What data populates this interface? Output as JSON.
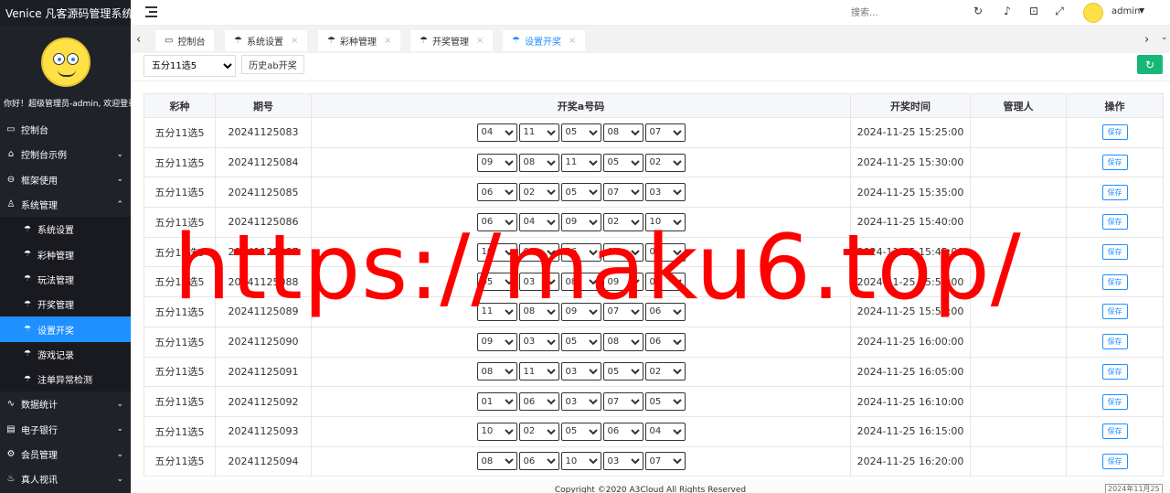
{
  "app": {
    "title": "Venice 凡客源码管理系统",
    "welcome": "你好！超级管理员-admin, 欢迎登录"
  },
  "sidebar": {
    "items": [
      {
        "label": "控制台",
        "icon": "monitor-icon",
        "glyph": "▭",
        "chevron": ""
      },
      {
        "label": "控制台示例",
        "icon": "home-icon",
        "glyph": "⌂",
        "chevron": "⌄"
      },
      {
        "label": "框架使用",
        "icon": "framework-icon",
        "glyph": "⊖",
        "chevron": "⌄"
      },
      {
        "label": "系统管理",
        "icon": "user-icon",
        "glyph": "♙",
        "chevron": "⌃"
      }
    ],
    "sub_items": [
      {
        "label": "系统设置",
        "icon": "umbrella-icon",
        "glyph": "☂",
        "active": false
      },
      {
        "label": "彩种管理",
        "icon": "umbrella-icon",
        "glyph": "☂",
        "active": false
      },
      {
        "label": "玩法管理",
        "icon": "umbrella-icon",
        "glyph": "☂",
        "active": false
      },
      {
        "label": "开奖管理",
        "icon": "umbrella-icon",
        "glyph": "☂",
        "active": false
      },
      {
        "label": "设置开奖",
        "icon": "umbrella-icon",
        "glyph": "☂",
        "active": true
      },
      {
        "label": "游戏记录",
        "icon": "umbrella-icon",
        "glyph": "☂",
        "active": false
      },
      {
        "label": "注单异常检测",
        "icon": "umbrella-icon",
        "glyph": "☂",
        "active": false
      }
    ],
    "bottom_items": [
      {
        "label": "数据统计",
        "icon": "stats-icon",
        "glyph": "∿",
        "chevron": "⌄"
      },
      {
        "label": "电子银行",
        "icon": "bank-icon",
        "glyph": "▤",
        "chevron": "⌄"
      },
      {
        "label": "会员管理",
        "icon": "gear-icon",
        "glyph": "⚙",
        "chevron": "⌄"
      },
      {
        "label": "真人视讯",
        "icon": "video-icon",
        "glyph": "♨",
        "chevron": "⌄"
      }
    ]
  },
  "header": {
    "search_placeholder": "搜索...",
    "user_name": "admin",
    "icons": [
      "refresh-icon",
      "bell-icon",
      "lock-icon",
      "fullscreen-icon"
    ]
  },
  "tabs": [
    {
      "label": "控制台",
      "closable": false,
      "active": false
    },
    {
      "label": "系统设置",
      "closable": true,
      "active": false
    },
    {
      "label": "彩种管理",
      "closable": true,
      "active": false
    },
    {
      "label": "开奖管理",
      "closable": true,
      "active": false
    },
    {
      "label": "设置开奖",
      "closable": true,
      "active": true
    }
  ],
  "toolbar": {
    "lottery_selected": "五分11选5",
    "history_button": "历史ab开奖"
  },
  "table": {
    "headers": [
      "彩种",
      "期号",
      "开奖a号码",
      "开奖时间",
      "管理人",
      "操作"
    ],
    "save_label": "保存",
    "rows": [
      {
        "lottery": "五分11选5",
        "issue": "20241125083",
        "nums": [
          "04",
          "11",
          "05",
          "08",
          "07"
        ],
        "time": "2024-11-25 15:25:00",
        "manager": ""
      },
      {
        "lottery": "五分11选5",
        "issue": "20241125084",
        "nums": [
          "09",
          "08",
          "11",
          "05",
          "02"
        ],
        "time": "2024-11-25 15:30:00",
        "manager": ""
      },
      {
        "lottery": "五分11选5",
        "issue": "20241125085",
        "nums": [
          "06",
          "02",
          "05",
          "07",
          "03"
        ],
        "time": "2024-11-25 15:35:00",
        "manager": ""
      },
      {
        "lottery": "五分11选5",
        "issue": "20241125086",
        "nums": [
          "06",
          "04",
          "09",
          "02",
          "10"
        ],
        "time": "2024-11-25 15:40:00",
        "manager": ""
      },
      {
        "lottery": "五分11选5",
        "issue": "20241125087",
        "nums": [
          "10",
          "08",
          "06",
          "02",
          "07"
        ],
        "time": "2024-11-25 15:45:00",
        "manager": ""
      },
      {
        "lottery": "五分11选5",
        "issue": "20241125088",
        "nums": [
          "05",
          "03",
          "08",
          "09",
          "01"
        ],
        "time": "2024-11-25 15:50:00",
        "manager": ""
      },
      {
        "lottery": "五分11选5",
        "issue": "20241125089",
        "nums": [
          "11",
          "08",
          "09",
          "07",
          "06"
        ],
        "time": "2024-11-25 15:55:00",
        "manager": ""
      },
      {
        "lottery": "五分11选5",
        "issue": "20241125090",
        "nums": [
          "09",
          "03",
          "05",
          "08",
          "06"
        ],
        "time": "2024-11-25 16:00:00",
        "manager": ""
      },
      {
        "lottery": "五分11选5",
        "issue": "20241125091",
        "nums": [
          "08",
          "11",
          "03",
          "05",
          "02"
        ],
        "time": "2024-11-25 16:05:00",
        "manager": ""
      },
      {
        "lottery": "五分11选5",
        "issue": "20241125092",
        "nums": [
          "01",
          "06",
          "03",
          "07",
          "05"
        ],
        "time": "2024-11-25 16:10:00",
        "manager": ""
      },
      {
        "lottery": "五分11选5",
        "issue": "20241125093",
        "nums": [
          "10",
          "02",
          "05",
          "06",
          "04"
        ],
        "time": "2024-11-25 16:15:00",
        "manager": ""
      },
      {
        "lottery": "五分11选5",
        "issue": "20241125094",
        "nums": [
          "08",
          "06",
          "10",
          "03",
          "07"
        ],
        "time": "2024-11-25 16:20:00",
        "manager": ""
      }
    ]
  },
  "footer": {
    "copyright": "Copyright ©2020 A3Cloud All Rights Reserved",
    "date_corner": "2024年11月25"
  },
  "watermark": "https://maku6.top/",
  "colors": {
    "sidebar_bg": "#20222a",
    "active_blue": "#1e90ff",
    "refresh_green": "#16b777",
    "watermark_red": "#ff0000"
  }
}
